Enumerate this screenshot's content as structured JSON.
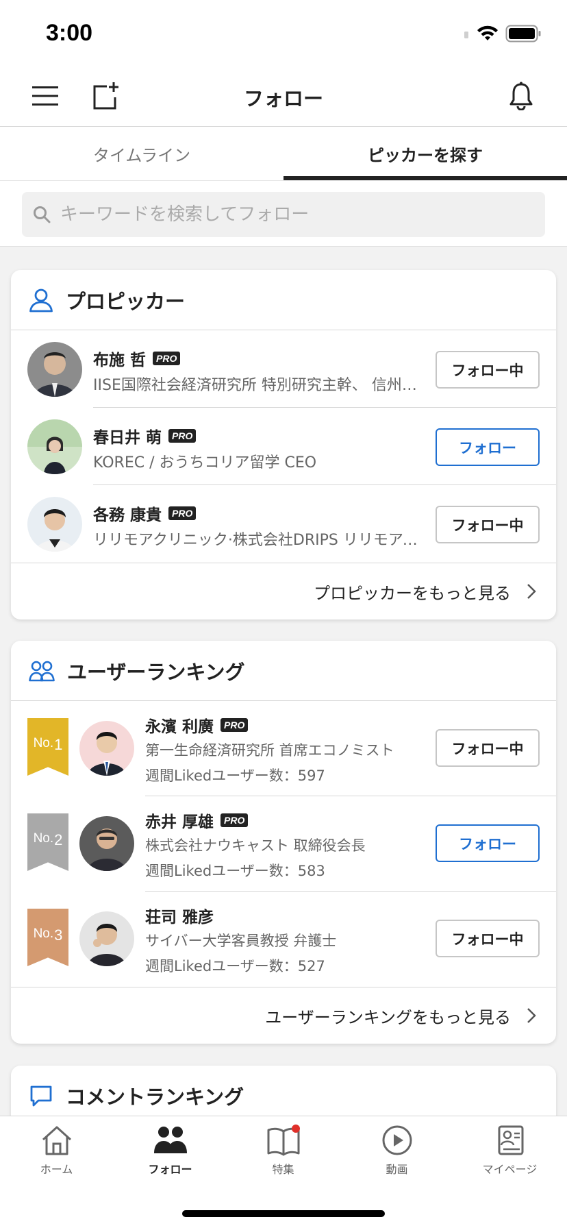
{
  "status": {
    "time": "3:00"
  },
  "nav": {
    "title": "フォロー"
  },
  "tabs": [
    {
      "label": "タイムライン",
      "active": false
    },
    {
      "label": "ピッカーを探す",
      "active": true
    }
  ],
  "search": {
    "placeholder": "キーワードを検索してフォロー"
  },
  "pro_pickers": {
    "title": "プロピッカー",
    "items": [
      {
        "name": "布施 哲",
        "badge": "PRO",
        "desc": "IISE国際社会経済研究所 特別研究主幹、 信州大学特任教授",
        "button": "フォロー中"
      },
      {
        "name": "春日井 萌",
        "badge": "PRO",
        "desc": "KOREC / おうちコリア留学 CEO",
        "button": "フォロー"
      },
      {
        "name": "各務 康貴",
        "badge": "PRO",
        "desc": "リリモアクリニック·株式会社DRIPS リリモアクリニック院長",
        "button": "フォロー中"
      }
    ],
    "more": "プロピッカーをもっと見る"
  },
  "user_ranking": {
    "title": "ユーザーランキング",
    "items": [
      {
        "rank_prefix": "No.",
        "rank": "1",
        "name": "永濱 利廣",
        "badge": "PRO",
        "desc": "第一生命経済研究所 首席エコノミスト",
        "liked": "週間Likedユーザー数：597",
        "button": "フォロー中",
        "ribbon_color": "#e2b628"
      },
      {
        "rank_prefix": "No.",
        "rank": "2",
        "name": "赤井 厚雄",
        "badge": "PRO",
        "desc": "株式会社ナウキャスト 取締役会長",
        "liked": "週間Likedユーザー数：583",
        "button": "フォロー",
        "ribbon_color": "#a9a9a9"
      },
      {
        "rank_prefix": "No.",
        "rank": "3",
        "name": "荘司 雅彦",
        "badge": "",
        "desc": "サイバー大学客員教授 弁護士",
        "liked": "週間Likedユーザー数：527",
        "button": "フォロー中",
        "ribbon_color": "#d49a70"
      }
    ],
    "more": "ユーザーランキングをもっと見る"
  },
  "comment_ranking": {
    "title": "コメントランキング"
  },
  "bottom_tabs": [
    {
      "label": "ホーム",
      "icon": "home-icon"
    },
    {
      "label": "フォロー",
      "icon": "people-icon",
      "active": true
    },
    {
      "label": "特集",
      "icon": "book-icon",
      "badge_color": "#e0302a"
    },
    {
      "label": "動画",
      "icon": "play-icon"
    },
    {
      "label": "マイページ",
      "icon": "profile-card-icon"
    }
  ],
  "colors": {
    "accent": "#1f6fd1",
    "text": "#222222",
    "notification_dot": "#e0302a"
  }
}
